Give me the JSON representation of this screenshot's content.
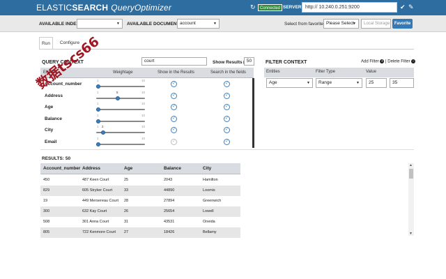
{
  "header": {
    "brand_part1": "ELASTIC",
    "brand_part2": "SEARCH",
    "brand_part3": "QueryOptimizer",
    "status": "Connected",
    "server_label": "SERVER:",
    "server_url": "http://  10.240.0.251:9200",
    "refresh_icon": "refresh-icon",
    "check_icon": "check-icon",
    "edit_icon": "pencil-icon"
  },
  "selectors": {
    "indexes_label": "AVAILABLE INDEXES:",
    "indexes_value": "",
    "documents_label": "AVAILABLE DOCUMENTS:",
    "documents_value": "account",
    "favorite_label": "Select from favorite:",
    "favorite_value": "Please Select",
    "local_storage_placeholder": "Local Storage ?",
    "favorite_button": "Favorite"
  },
  "tabs": [
    {
      "label": "Run",
      "active": true
    },
    {
      "label": "Configure",
      "active": false
    }
  ],
  "query_context": {
    "title": "QUERY CONTEXT",
    "search_value": "court",
    "show_results_label": "Show Results ▶",
    "show_results_count": "50",
    "columns": [
      "Entities",
      "Weightage",
      "Show in the Results",
      "Search in the fields"
    ],
    "rows": [
      {
        "name": "Account_number",
        "weight": 1,
        "min": "1",
        "max": "10",
        "show": true,
        "search": true,
        "show_mid": false
      },
      {
        "name": "Address",
        "weight": 5,
        "min": "1",
        "max": "10",
        "show": true,
        "search": true,
        "show_mid": true
      },
      {
        "name": "Age",
        "weight": 1,
        "min": "1",
        "max": "10",
        "show": true,
        "search": true,
        "show_mid": false
      },
      {
        "name": "Balance",
        "weight": 1,
        "min": "1",
        "max": "10",
        "show": true,
        "search": true,
        "show_mid": false
      },
      {
        "name": "City",
        "weight": 2,
        "min": "1",
        "max": "10",
        "show": true,
        "search": true,
        "show_mid": true
      },
      {
        "name": "Email",
        "weight": 1,
        "min": "1",
        "max": "10",
        "show": false,
        "search": true,
        "show_mid": false
      }
    ]
  },
  "filter_context": {
    "title": "FILTER CONTEXT",
    "add_filter": "Add Filter",
    "delete_filter": "Delete Filter",
    "separator": "|",
    "columns": [
      "Entities",
      "Filter Type",
      "Value"
    ],
    "row": {
      "entity": "Age",
      "type": "Range",
      "from": "25",
      "to": "35"
    }
  },
  "results": {
    "title": "RESULTS: 50",
    "columns": [
      "Account_number",
      "Address",
      "Age",
      "Balance",
      "City"
    ],
    "rows": [
      [
        "450",
        "487 Keen Court",
        "25",
        "2043",
        "Hamilton"
      ],
      [
        "829",
        "605 Stryker Court",
        "33",
        "44890",
        "Loomis"
      ],
      [
        "19",
        "449 Mersereau Court",
        "28",
        "27894",
        "Greenwich"
      ],
      [
        "300",
        "632 Kay Court",
        "26",
        "25654",
        "Lowell"
      ],
      [
        "508",
        "301 Anna Court",
        "31",
        "43531",
        "Oneida"
      ],
      [
        "805",
        "722 Kenmore Court",
        "27",
        "18426",
        "Bellamy"
      ]
    ]
  },
  "watermark": {
    "text_line1": "数据",
    "text_line2": "tscs66"
  },
  "colors": {
    "topbar": "#2e6d9f",
    "connected": "#2e8b3a",
    "accent": "#337ab7",
    "watermark": "#a01622"
  }
}
